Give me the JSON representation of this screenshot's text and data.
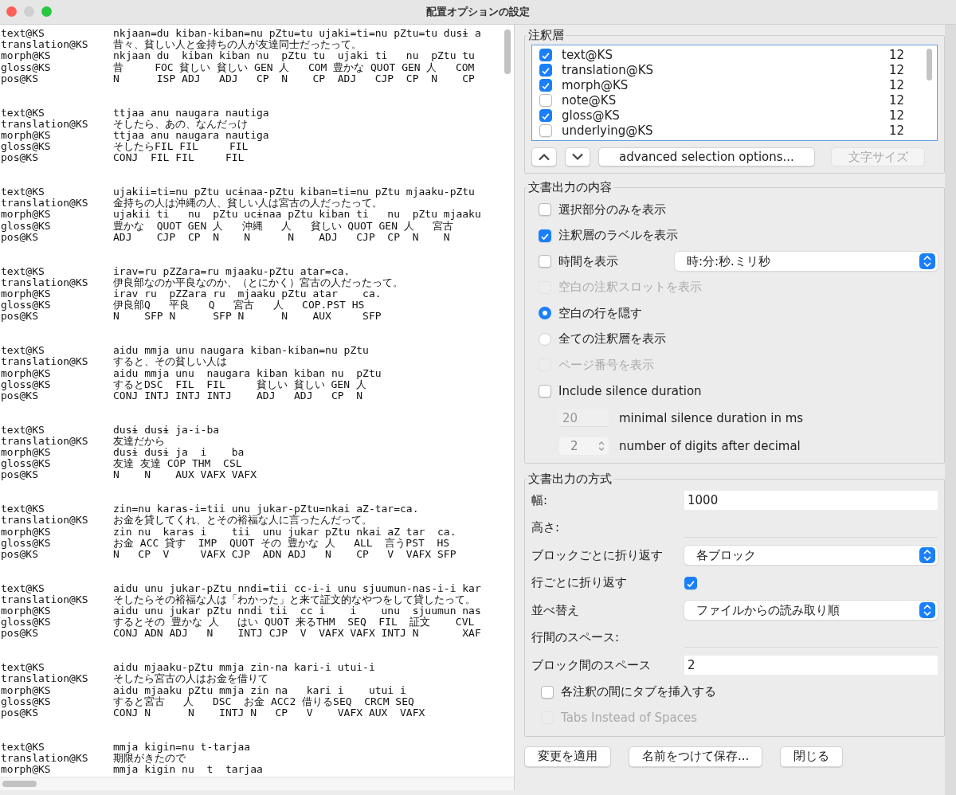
{
  "window": {
    "title": "配置オプションの設定"
  },
  "preview": {
    "blocks": [
      {
        "rows": [
          {
            "tier": "text@KS",
            "text": "nkjaan=du kiban-kiban=nu pZtu=tu ujaki=ti=nu pZtu=tu dusɨ a"
          },
          {
            "tier": "translation@KS",
            "text": "昔々、貧しい人と金持ちの人が友達同士だったって。"
          },
          {
            "tier": "morph@KS",
            "text": "nkjaan du  kiban kiban nu  pZtu tu  ujaki ti   nu  pZtu tu"
          },
          {
            "tier": "gloss@KS",
            "text": "昔     FOC 貧しい 貧しい GEN 人   COM 豊かな QUOT GEN 人   COM"
          },
          {
            "tier": "pos@KS",
            "text": "N      ISP ADJ   ADJ   CP  N    CP  ADJ   CJP  CP  N    CP"
          }
        ]
      },
      {
        "rows": [
          {
            "tier": "text@KS",
            "text": "ttjaa anu naugara nautiga"
          },
          {
            "tier": "translation@KS",
            "text": "そしたら、あの、なんだっけ"
          },
          {
            "tier": "morph@KS",
            "text": "ttjaa anu naugara nautiga"
          },
          {
            "tier": "gloss@KS",
            "text": "そしたらFIL FIL     FIL"
          },
          {
            "tier": "pos@KS",
            "text": "CONJ  FIL FIL     FIL"
          }
        ]
      },
      {
        "rows": [
          {
            "tier": "text@KS",
            "text": "ujakii=ti=nu pZtu ucɨnaa-pZtu kiban=ti=nu pZtu mjaaku-pZtu"
          },
          {
            "tier": "translation@KS",
            "text": "金持ちの人は沖縄の人、貧しい人は宮古の人だったって。"
          },
          {
            "tier": "morph@KS",
            "text": "ujakii ti   nu  pZtu ucɨnaa pZtu kiban ti   nu  pZtu mjaaku"
          },
          {
            "tier": "gloss@KS",
            "text": "豊かな  QUOT GEN 人   沖縄   人   貧しい QUOT GEN 人   宮古"
          },
          {
            "tier": "pos@KS",
            "text": "ADJ    CJP  CP  N    N      N    ADJ   CJP  CP  N    N"
          }
        ]
      },
      {
        "rows": [
          {
            "tier": "text@KS",
            "text": "irav=ru pZZara=ru mjaaku-pZtu atar=ca."
          },
          {
            "tier": "translation@KS",
            "text": "伊良部なのか平良なのか、（とにかく）宮古の人だったって。"
          },
          {
            "tier": "morph@KS",
            "text": "irav ru  pZZara ru  mjaaku pZtu atar    ca."
          },
          {
            "tier": "gloss@KS",
            "text": "伊良部Q   平良   Q   宮古   人   COP.PST HS"
          },
          {
            "tier": "pos@KS",
            "text": "N    SFP N      SFP N      N    AUX     SFP"
          }
        ]
      },
      {
        "rows": [
          {
            "tier": "text@KS",
            "text": "aidu mmja unu naugara kiban-kiban=nu pZtu"
          },
          {
            "tier": "translation@KS",
            "text": "すると、その貧しい人は"
          },
          {
            "tier": "morph@KS",
            "text": "aidu mmja unu  naugara kiban kiban nu  pZtu"
          },
          {
            "tier": "gloss@KS",
            "text": "するとDSC  FIL  FIL     貧しい 貧しい GEN 人"
          },
          {
            "tier": "pos@KS",
            "text": "CONJ INTJ INTJ INTJ    ADJ   ADJ   CP  N"
          }
        ]
      },
      {
        "rows": [
          {
            "tier": "text@KS",
            "text": "dusɨ dusɨ ja-i-ba"
          },
          {
            "tier": "translation@KS",
            "text": "友達だから"
          },
          {
            "tier": "morph@KS",
            "text": "dusɨ dusɨ ja  i    ba"
          },
          {
            "tier": "gloss@KS",
            "text": "友達 友達 COP THM  CSL"
          },
          {
            "tier": "pos@KS",
            "text": "N    N    AUX VAFX VAFX"
          }
        ]
      },
      {
        "rows": [
          {
            "tier": "text@KS",
            "text": "zin=nu karas-i=tii unu jukar-pZtu=nkai aZ-tar=ca."
          },
          {
            "tier": "translation@KS",
            "text": "お金を貸してくれ、とその裕福な人に言ったんだって。"
          },
          {
            "tier": "morph@KS",
            "text": "zin nu  karas i    tii  unu jukar pZtu nkai aZ tar  ca."
          },
          {
            "tier": "gloss@KS",
            "text": "お金 ACC 貸す  IMP  QUOT その 豊かな 人   ALL  言うPST  HS"
          },
          {
            "tier": "pos@KS",
            "text": "N   CP  V     VAFX CJP  ADN ADJ   N    CP   V  VAFX SFP"
          }
        ]
      },
      {
        "rows": [
          {
            "tier": "text@KS",
            "text": "aidu unu jukar-pZtu nndi=tii cc-i-i unu sjuumun-nas-i-i kar"
          },
          {
            "tier": "translation@KS",
            "text": "そしたらその裕福な人は「わかった」と来て証文的なやつをして貸したって。"
          },
          {
            "tier": "morph@KS",
            "text": "aidu unu jukar pZtu nndi tii  cc i    i    unu  sjuumun nas"
          },
          {
            "tier": "gloss@KS",
            "text": "するとその 豊かな 人   はい QUOT 来るTHM  SEQ  FIL  証文    CVL"
          },
          {
            "tier": "pos@KS",
            "text": "CONJ ADN ADJ   N    INTJ CJP  V  VAFX VAFX INTJ N       XAF"
          }
        ]
      },
      {
        "rows": [
          {
            "tier": "text@KS",
            "text": "aidu mjaaku-pZtu mmja zin-na kari-i utui-i"
          },
          {
            "tier": "translation@KS",
            "text": "そしたら宮古の人はお金を借りて"
          },
          {
            "tier": "morph@KS",
            "text": "aidu mjaaku pZtu mmja zin na   kari i    utui i"
          },
          {
            "tier": "gloss@KS",
            "text": "すると宮古   人   DSC  お金 ACC2 借りるSEQ  CRCM SEQ"
          },
          {
            "tier": "pos@KS",
            "text": "CONJ N      N    INTJ N   CP   V    VAFX AUX  VAFX"
          }
        ]
      },
      {
        "rows": [
          {
            "tier": "text@KS",
            "text": "mmja kigin=nu t-tarjaa"
          },
          {
            "tier": "translation@KS",
            "text": "期限がきたので"
          },
          {
            "tier": "morph@KS",
            "text": "mmja kigin nu  t  tarjaa"
          }
        ]
      }
    ]
  },
  "tiers": {
    "title": "注釈層",
    "items": [
      {
        "name": "text@KS",
        "size": "12",
        "checked": true
      },
      {
        "name": "translation@KS",
        "size": "12",
        "checked": true
      },
      {
        "name": "morph@KS",
        "size": "12",
        "checked": true
      },
      {
        "name": "note@KS",
        "size": "12",
        "checked": false
      },
      {
        "name": "gloss@KS",
        "size": "12",
        "checked": true
      },
      {
        "name": "underlying@KS",
        "size": "12",
        "checked": false
      }
    ],
    "advanced_button": "advanced selection options...",
    "font_size_button": {
      "label": "文字サイズ",
      "disabled": true
    }
  },
  "content": {
    "title": "文書出力の内容",
    "options": [
      {
        "kind": "checkbox",
        "label": "選択部分のみを表示",
        "checked": false,
        "disabled": false
      },
      {
        "kind": "checkbox",
        "label": "注釈層のラベルを表示",
        "checked": true,
        "disabled": false
      },
      {
        "kind": "checkbox",
        "label": "時間を表示",
        "checked": false,
        "disabled": false,
        "select": "時:分:秒.ミリ秒"
      },
      {
        "kind": "checkbox",
        "label": "空白の注釈スロットを表示",
        "checked": false,
        "disabled": true
      },
      {
        "kind": "radio",
        "label": "空白の行を隠す",
        "selected": true,
        "disabled": false
      },
      {
        "kind": "radio",
        "label": "全ての注釈層を表示",
        "selected": false,
        "disabled": false
      },
      {
        "kind": "checkbox",
        "label": "ページ番号を表示",
        "checked": false,
        "disabled": true
      },
      {
        "kind": "checkbox",
        "label": "Include silence duration",
        "checked": false,
        "disabled": false,
        "fields": [
          {
            "kind": "number",
            "value": "20",
            "label": "minimal silence duration in ms",
            "disabled": true
          },
          {
            "kind": "spinner",
            "value": "2",
            "label": "number of digits after decimal",
            "disabled": true
          }
        ]
      }
    ]
  },
  "format": {
    "title": "文書出力の方式",
    "rows": [
      {
        "kind": "text",
        "label": "幅:",
        "value": "1000"
      },
      {
        "kind": "line",
        "label": "高さ:"
      },
      {
        "kind": "select",
        "label": "ブロックごとに折り返す",
        "value": "各ブロック"
      },
      {
        "kind": "checkbox",
        "label": "行ごとに折り返す",
        "checked": true
      },
      {
        "kind": "select",
        "label": "並べ替え",
        "value": "ファイルからの読み取り順"
      },
      {
        "kind": "line",
        "label": "行間のスペース:"
      },
      {
        "kind": "text",
        "label": "ブロック間のスペース",
        "value": "2"
      }
    ],
    "options": [
      {
        "label": "各注釈の間にタブを挿入する",
        "checked": false,
        "disabled": false
      },
      {
        "label": "Tabs Instead of Spaces",
        "checked": false,
        "disabled": true
      }
    ]
  },
  "buttons": [
    "変更を適用",
    "名前をつけて保存...",
    "閉じる"
  ]
}
